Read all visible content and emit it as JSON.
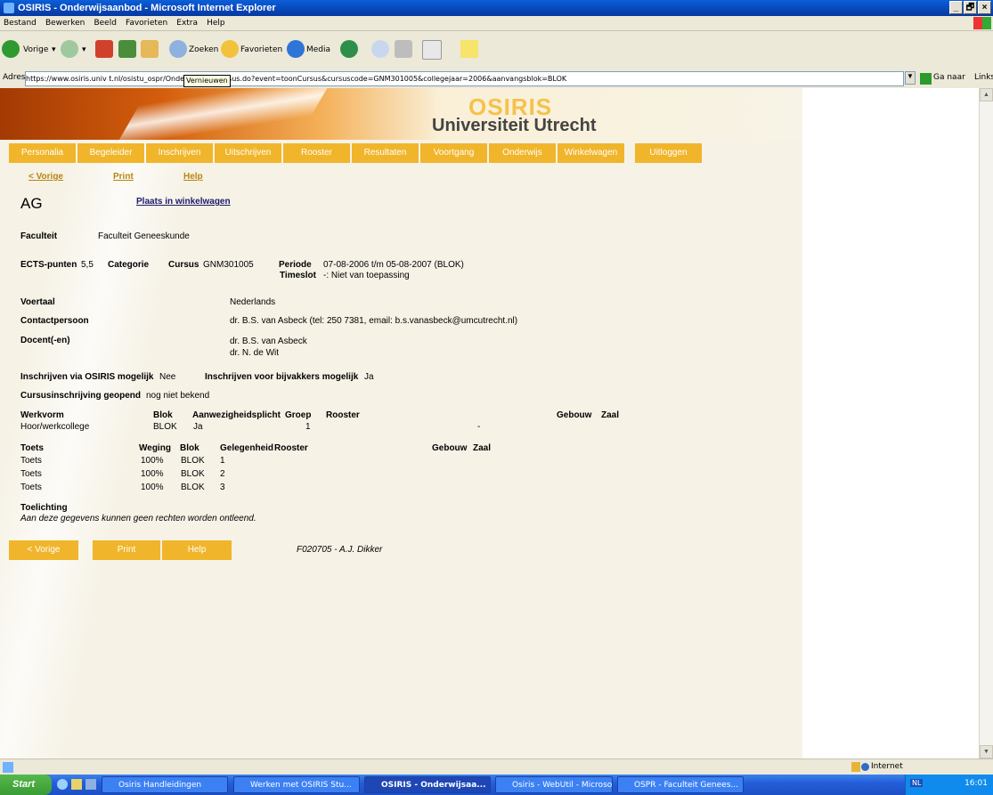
{
  "window": {
    "title": "OSIRIS - Onderwijsaanbod - Microsoft Internet Explorer",
    "controls": [
      "_",
      "🗗",
      "×"
    ]
  },
  "menu": [
    "Bestand",
    "Bewerken",
    "Beeld",
    "Favorieten",
    "Extra",
    "Help"
  ],
  "toolbar": {
    "back": "Vorige",
    "search": "Zoeken",
    "favorites": "Favorieten",
    "media": "Media",
    "tooltip": "Vernieuwen"
  },
  "address": {
    "label": "Adres",
    "url": "https://www.osiris.univ                 t.nl/osistu_ospr/OnderwijsKiesCursus.do?event=toonCursus&cursuscode=GNM301005&collegejaar=2006&aanvangsblok=BLOK",
    "go": "Ga naar",
    "links": "Links"
  },
  "logo": {
    "osiris": "OSIRIS",
    "university": "Universiteit Utrecht"
  },
  "nav": [
    "Personalia",
    "Begeleider",
    "Inschrijven",
    "Uitschrijven",
    "Rooster",
    "Resultaten",
    "Voortgang",
    "Onderwijs",
    "Winkelwagen",
    "Uitloggen"
  ],
  "sublinks": {
    "prev": "< Vorige",
    "print": "Print",
    "help": "Help"
  },
  "course": {
    "title": "AG",
    "add_to_cart": "Plaats in winkelwagen",
    "faculty_label": "Faculteit",
    "faculty": "Faculteit Geneeskunde",
    "ects_label": "ECTS-punten",
    "ects": "5,5",
    "category_label": "Categorie",
    "cursus_label": "Cursus",
    "cursus": "GNM301005",
    "periode_label": "Periode",
    "periode": "07-08-2006 t/m 05-08-2007 (BLOK)",
    "timeslot_label": "Timeslot",
    "timeslot": "-: Niet van toepassing",
    "voertaal_label": "Voertaal",
    "voertaal": "Nederlands",
    "contact_label": "Contactpersoon",
    "contact": "dr. B.S. van Asbeck (tel: 250 7381, email: b.s.vanasbeck@umcutrecht.nl)",
    "docent_label": "Docent(-en)",
    "docent1": "dr. B.S. van Asbeck",
    "docent2": "dr. N. de Wit",
    "osiris_enrol_label": "Inschrijven via OSIRIS mogelijk",
    "osiris_enrol": "Nee",
    "bijvak_label": "Inschrijven voor bijvakkers mogelijk",
    "bijvak": "Ja",
    "opened_label": "Cursusinschrijving geopend",
    "opened": "nog niet bekend",
    "toelichting_label": "Toelichting",
    "disclaimer": "Aan deze gegevens kunnen geen rechten worden ontleend."
  },
  "werkvorm": {
    "headers": [
      "Werkvorm",
      "Blok",
      "Aanwezigheidsplicht",
      "Groep",
      "Rooster",
      "Gebouw",
      "Zaal"
    ],
    "row": [
      "Hoor/werkcollege",
      "BLOK",
      "Ja",
      "1",
      "-"
    ]
  },
  "toets": {
    "headers": [
      "Toets",
      "Weging",
      "Blok",
      "Gelegenheid",
      "Rooster",
      "Gebouw",
      "Zaal"
    ],
    "rows": [
      [
        "Toets",
        "100%",
        "BLOK",
        "1"
      ],
      [
        "Toets",
        "100%",
        "BLOK",
        "2"
      ],
      [
        "Toets",
        "100%",
        "BLOK",
        "3"
      ]
    ]
  },
  "bottom_buttons": [
    "< Vorige",
    "Print",
    "Help"
  ],
  "footer_code": "F020705 - A.J. Dikker",
  "status": {
    "zone": "Internet"
  },
  "taskbar": {
    "start": "Start",
    "tasks": [
      "Osiris Handleidingen",
      "Werken met OSIRIS Stu...",
      "OSIRIS - Onderwijsaa...",
      "Osiris - WebUtil - Microso...",
      "OSPR - Faculteit Genees..."
    ],
    "lang": "NL",
    "clock": "16:01"
  }
}
